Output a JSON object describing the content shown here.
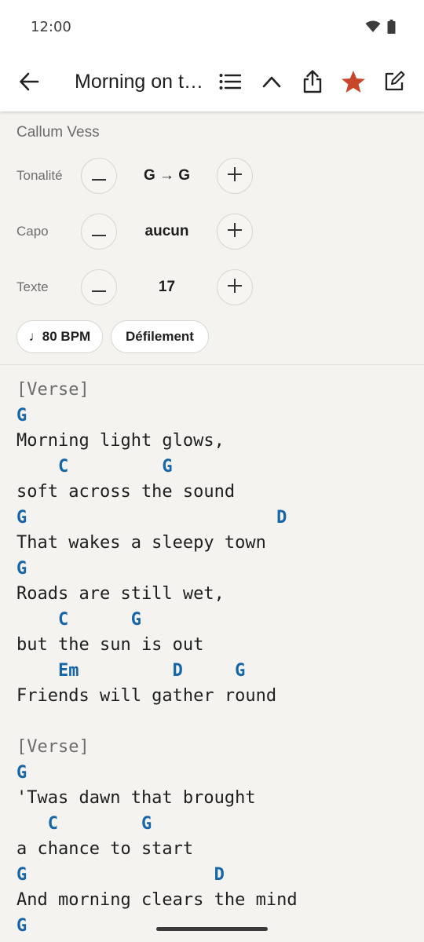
{
  "status": {
    "time": "12:00"
  },
  "appbar": {
    "title": "Morning on t…",
    "icons": [
      "back-arrow-icon",
      "list-icon",
      "chevron-up-icon",
      "share-icon",
      "star-icon",
      "edit-icon"
    ],
    "accent_star": "#c8472a"
  },
  "controls": {
    "artist": "Callum Vess",
    "key": {
      "label": "Tonalité",
      "value": "G → G"
    },
    "capo": {
      "label": "Capo",
      "value": "aucun"
    },
    "text": {
      "label": "Texte",
      "value": "17"
    },
    "bpm_label": "♩80 BPM",
    "scroll_label": "Défilement"
  },
  "sheet": {
    "lines": [
      {
        "type": "section",
        "text": "[Verse]"
      },
      {
        "type": "chord",
        "text": "G"
      },
      {
        "type": "lyric",
        "text": "Morning light glows,"
      },
      {
        "type": "chord",
        "text": "    C         G"
      },
      {
        "type": "lyric",
        "text": "soft across the sound"
      },
      {
        "type": "chord",
        "text": "G                        D"
      },
      {
        "type": "lyric",
        "text": "That wakes a sleepy town"
      },
      {
        "type": "chord",
        "text": "G"
      },
      {
        "type": "lyric",
        "text": "Roads are still wet,"
      },
      {
        "type": "chord",
        "text": "    C      G"
      },
      {
        "type": "lyric",
        "text": "but the sun is out"
      },
      {
        "type": "chord",
        "text": "    Em         D     G"
      },
      {
        "type": "lyric",
        "text": "Friends will gather round"
      },
      {
        "type": "blank",
        "text": ""
      },
      {
        "type": "section",
        "text": "[Verse]"
      },
      {
        "type": "chord",
        "text": "G"
      },
      {
        "type": "lyric",
        "text": "'Twas dawn that brought"
      },
      {
        "type": "chord",
        "text": "   C        G"
      },
      {
        "type": "lyric",
        "text": "a chance to start"
      },
      {
        "type": "chord",
        "text": "G                  D"
      },
      {
        "type": "lyric",
        "text": "And morning clears the mind"
      },
      {
        "type": "chord",
        "text": "G"
      }
    ]
  }
}
